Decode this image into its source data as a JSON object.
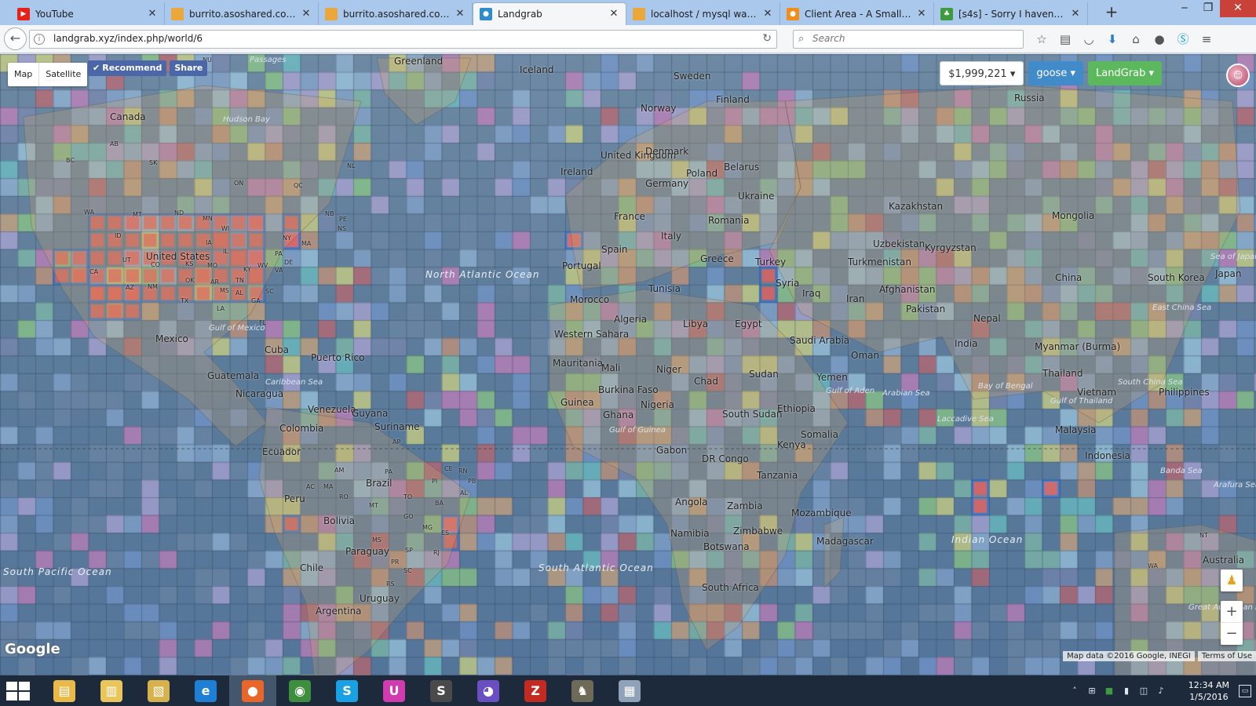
{
  "browser": {
    "tabs": [
      {
        "title": "YouTube",
        "favicon": "youtube-icon",
        "favicon_color": "#e62117",
        "favicon_glyph": "▶",
        "active": false
      },
      {
        "title": "burrito.asoshared.com /...",
        "favicon": "phpmyadmin-icon",
        "favicon_color": "#e9a73c",
        "favicon_glyph": "PMA",
        "active": false
      },
      {
        "title": "burrito.asoshared.com /...",
        "favicon": "phpmyadmin-icon",
        "favicon_color": "#e9a73c",
        "favicon_glyph": "PMA",
        "active": false
      },
      {
        "title": "Landgrab",
        "favicon": "globe-icon",
        "favicon_color": "#2c8bd1",
        "favicon_glyph": "●",
        "active": true
      },
      {
        "title": "localhost / mysql wamp...",
        "favicon": "phpmyadmin-icon",
        "favicon_color": "#e9a73c",
        "favicon_glyph": "PMA",
        "active": false
      },
      {
        "title": "Client Area - A Small Or...",
        "favicon": "orange-icon",
        "favicon_color": "#f08d1b",
        "favicon_glyph": "●",
        "active": false
      },
      {
        "title": "[s4s] - Sorry I haven't be...",
        "favicon": "clover-icon",
        "favicon_color": "#3e9b3e",
        "favicon_glyph": "♣",
        "active": false
      }
    ],
    "url": "landgrab.xyz/index.php/world/6",
    "search_placeholder": "Search"
  },
  "map": {
    "type_controls": {
      "map": "Map",
      "satellite": "Satellite"
    },
    "facebook": {
      "recommend": "Recommend",
      "share": "Share"
    },
    "balance": "$1,999,221",
    "username": "goose",
    "game_menu": "LandGrab",
    "google_logo": "Google",
    "attribution": "Map data ©2016 Google, INEGI",
    "terms": "Terms of Use",
    "labels": {
      "countries": [
        "Canada",
        "Greenland",
        "Iceland",
        "Sweden",
        "Finland",
        "Norway",
        "Russia",
        "United Kingdom",
        "Ireland",
        "Denmark",
        "Poland",
        "Belarus",
        "Germany",
        "Ukraine",
        "France",
        "Romania",
        "Kazakhstan",
        "Mongolia",
        "Italy",
        "Spain",
        "Portugal",
        "Greece",
        "Turkey",
        "Uzbekistan",
        "Kyrgyzstan",
        "Turkmenistan",
        "China",
        "South Korea",
        "Japan",
        "Tunisia",
        "Syria",
        "Iraq",
        "Iran",
        "Afghanistan",
        "Pakistan",
        "Nepal",
        "Morocco",
        "Algeria",
        "Libya",
        "Egypt",
        "Saudi Arabia",
        "India",
        "Myanmar (Burma)",
        "Thailand",
        "Vietnam",
        "Philippines",
        "Western Sahara",
        "Mauritania",
        "Mali",
        "Niger",
        "Chad",
        "Sudan",
        "Oman",
        "Yemen",
        "Burkina Faso",
        "Guinea",
        "Ghana",
        "Nigeria",
        "South Sudan",
        "Ethiopia",
        "Somalia",
        "Malaysia",
        "Kenya",
        "Gabon",
        "DR Congo",
        "Tanzania",
        "Indonesia",
        "Angola",
        "Zambia",
        "Mozambique",
        "Namibia",
        "Zimbabwe",
        "Botswana",
        "Madagascar",
        "South Africa",
        "Australia",
        "United States",
        "Mexico",
        "Cuba",
        "Puerto Rico",
        "Guatemala",
        "Nicaragua",
        "Venezuela",
        "Guyana",
        "Suriname",
        "Colombia",
        "Ecuador",
        "Peru",
        "Brazil",
        "Bolivia",
        "Paraguay",
        "Chile",
        "Uruguay",
        "Argentina"
      ],
      "oceans": [
        "North Atlantic Ocean",
        "South Atlantic Ocean",
        "Indian Ocean",
        "South Pacific Ocean"
      ],
      "seas": [
        "Hudson Bay",
        "Gulf of Mexico",
        "Caribbean Sea",
        "Arabian Sea",
        "Bay of Bengal",
        "Gulf of Aden",
        "Laccadive Sea",
        "Gulf of Guinea",
        "South China Sea",
        "East China Sea",
        "Sea of Japan",
        "Banda Sea",
        "Arafura Sea",
        "Gulf of Thailand",
        "Great Australian Bight",
        "Passages"
      ],
      "states": [
        "AB",
        "BC",
        "SK",
        "ON",
        "QC",
        "NL",
        "NB",
        "PE",
        "NS",
        "WA",
        "MT",
        "ND",
        "MN",
        "WI",
        "ID",
        "IA",
        "IL",
        "NY",
        "MA",
        "UT",
        "CO",
        "KS",
        "MO",
        "KY",
        "WV",
        "PA",
        "DE",
        "VA",
        "CA",
        "AZ",
        "NM",
        "OK",
        "AR",
        "TN",
        "MS",
        "AL",
        "GA",
        "SC",
        "TX",
        "LA",
        "FL",
        "NU",
        "AM",
        "PA",
        "CE",
        "RN",
        "PB",
        "PI",
        "AL",
        "MA",
        "TO",
        "RO",
        "MT",
        "BA",
        "GO",
        "MG",
        "ES",
        "MS",
        "SP",
        "RJ",
        "PR",
        "SC",
        "RS",
        "AC",
        "AP",
        "NT",
        "WA"
      ]
    },
    "controls": {
      "pegman": "pegman-icon",
      "zoom_in": "+",
      "zoom_out": "−"
    }
  },
  "taskbar": {
    "apps": [
      {
        "name": "file-explorer-icon",
        "glyph": "▤",
        "color": "#e9b949"
      },
      {
        "name": "documents-icon",
        "glyph": "▥",
        "color": "#e9c55a"
      },
      {
        "name": "folder-icon",
        "glyph": "▧",
        "color": "#d7b24c"
      },
      {
        "name": "internet-explorer-icon",
        "glyph": "e",
        "color": "#1e7fd4"
      },
      {
        "name": "firefox-icon",
        "glyph": "●",
        "color": "#e8662a"
      },
      {
        "name": "chrome-icon",
        "glyph": "◉",
        "color": "#3d8f3d"
      },
      {
        "name": "skype-icon",
        "glyph": "S",
        "color": "#1aa1e3"
      },
      {
        "name": "u-app-icon",
        "glyph": "U",
        "color": "#d23bb0"
      },
      {
        "name": "sublime-text-icon",
        "glyph": "S",
        "color": "#4a4a4a"
      },
      {
        "name": "github-icon",
        "glyph": "◕",
        "color": "#6a4fc2"
      },
      {
        "name": "filezilla-icon",
        "glyph": "Z",
        "color": "#c22a22"
      },
      {
        "name": "gimp-icon",
        "glyph": "♞",
        "color": "#6e6a58"
      },
      {
        "name": "network-app-icon",
        "glyph": "▦",
        "color": "#8fa2b8"
      }
    ],
    "time": "12:34 AM",
    "date": "1/5/2016"
  }
}
